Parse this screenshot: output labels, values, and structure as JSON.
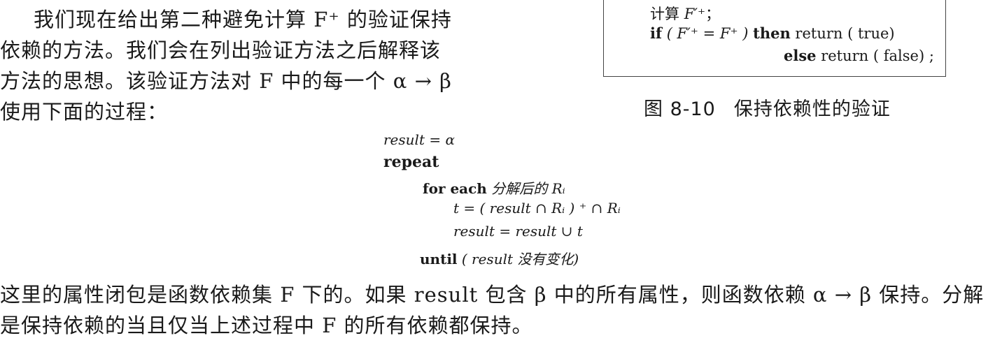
{
  "intro": {
    "line1": "我们现在给出第二种避免计算 F⁺ 的验证保持",
    "line2": "依赖的方法。我们会在列出验证方法之后解释该",
    "line3": "方法的思想。该验证方法对 F 中的每一个 α → β",
    "line4": "使用下面的过程："
  },
  "figure": {
    "line1_text": "计算 ",
    "line1_expr": "F′⁺",
    "line1_end": "；",
    "line2_kw_if": "if",
    "line2_cond": " ( F′⁺ = F⁺ ) ",
    "line2_kw_then": "then",
    "line2_rest": " return ( true)",
    "line3_kw_else": "else",
    "line3_rest": " return ( false) ;",
    "caption_number": "图 8-10",
    "caption_text": "保持依赖性的验证"
  },
  "algorithm": {
    "line1": "result = α",
    "line2": "repeat",
    "line3_kw": "for each",
    "line3_rest": " 分解后的 Rᵢ",
    "line4": "t = ( result ∩ Rᵢ ) ⁺ ∩ Rᵢ",
    "line5": "result = result ∪ t",
    "line6_kw": "until",
    "line6_rest": " ( result 没有变化)"
  },
  "tail": {
    "line1": "这里的属性闭包是函数依赖集 F 下的。如果 result 包含 β 中的所有属性，则函数依赖 α → β 保持。分解",
    "line2": "是保持依赖的当且仅当上述过程中 F 的所有依赖都保持。"
  }
}
